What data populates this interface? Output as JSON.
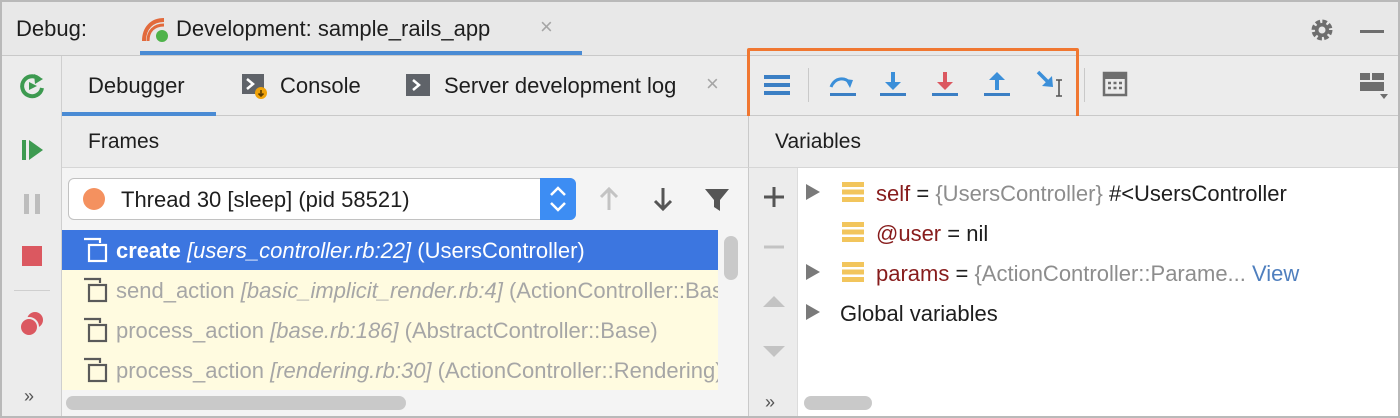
{
  "titlebar": {
    "label": "Debug:",
    "run_tab": "Development: sample_rails_app",
    "close_glyph": "×",
    "icons": [
      "rails-icon",
      "gear-icon",
      "minimize-icon"
    ]
  },
  "leftbar": {
    "icons": [
      "rerun-icon",
      "resume-icon",
      "pause-icon",
      "stop-icon",
      "view-breakpoints-icon"
    ],
    "more_glyph": "»"
  },
  "tabs": [
    {
      "label": "Debugger",
      "active": true
    },
    {
      "label": "Console",
      "icon": "console-icon"
    },
    {
      "label": "Server development log",
      "icon": "log-icon",
      "closable": true
    }
  ],
  "toolbar": {
    "icons": [
      "show-execution-point-icon",
      "step-over-icon",
      "step-into-icon",
      "force-step-into-icon",
      "step-out-icon",
      "run-to-cursor-icon",
      "evaluate-expression-icon",
      "layout-icon"
    ],
    "highlight_color": "#f07731"
  },
  "frames": {
    "title": "Frames",
    "thread": "Thread 30 [sleep] (pid 58521)",
    "rows": [
      {
        "method": "create",
        "file": "[users_controller.rb:22]",
        "klass": "(UsersController)",
        "selected": true
      },
      {
        "method": "send_action",
        "file": "[basic_implicit_render.rb:4]",
        "klass": "(ActionController::BasicImplicitRender)"
      },
      {
        "method": "process_action",
        "file": "[base.rb:186]",
        "klass": "(AbstractController::Base)"
      },
      {
        "method": "process_action",
        "file": "[rendering.rb:30]",
        "klass": "(ActionController::Rendering)"
      }
    ]
  },
  "variables": {
    "title": "Variables",
    "rows": [
      {
        "name": "self",
        "eq": " = ",
        "type": "{UsersController}",
        "value": " #<UsersController",
        "expandable": true
      },
      {
        "name": "@user",
        "eq": " = ",
        "type": "",
        "value": "nil",
        "expandable": false
      },
      {
        "name": "params",
        "eq": " = ",
        "type": "{ActionController::Parame...",
        "value": "",
        "link": " View",
        "expandable": true
      }
    ],
    "global": "Global variables",
    "more_glyph": "»"
  },
  "colors": {
    "accent": "#4a8bd4",
    "selected_row": "#3c76e0",
    "frame_row": "#fffbe0",
    "var_name": "#871c1c"
  }
}
